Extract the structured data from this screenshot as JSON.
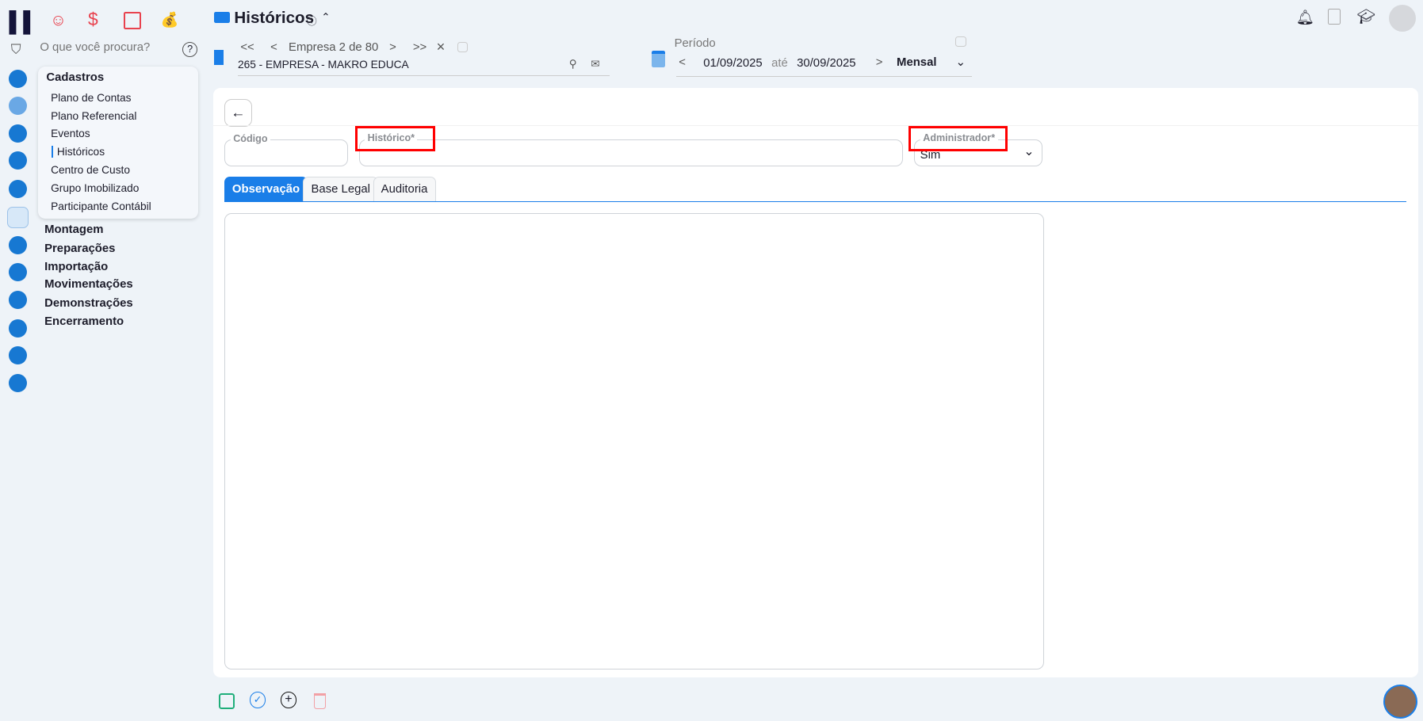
{
  "app": {
    "title": "Históricos"
  },
  "search": {
    "placeholder": "O que você procura?"
  },
  "company": {
    "nav_label": "Empresa 2 de 80",
    "first": "<<",
    "prev": "<",
    "next": ">",
    "last": ">>",
    "close": "×",
    "name": "265 - EMPRESA - MAKRO EDUCA"
  },
  "period": {
    "label": "Período",
    "start": "01/09/2025",
    "between": "até",
    "end": "30/09/2025",
    "mode": "Mensal"
  },
  "menu": {
    "section": "Cadastros",
    "items": [
      "Plano de Contas",
      "Plano Referencial",
      "Eventos",
      "Históricos",
      "Centro de Custo",
      "Grupo Imobilizado",
      "Participante Contábil"
    ],
    "active": "Históricos"
  },
  "sections": [
    "Montagem",
    "Preparações",
    "Importação",
    "Movimentações",
    "Demonstrações",
    "Encerramento"
  ],
  "form": {
    "codigo_label": "Código",
    "codigo_value": "",
    "historico_label": "Histórico*",
    "historico_value": "",
    "admin_label": "Administrador*",
    "admin_value": "Sim"
  },
  "tabs": [
    "Observação",
    "Base Legal",
    "Auditoria"
  ],
  "colors": {
    "accent": "#1a7ee8",
    "highlight": "#ff0000"
  }
}
